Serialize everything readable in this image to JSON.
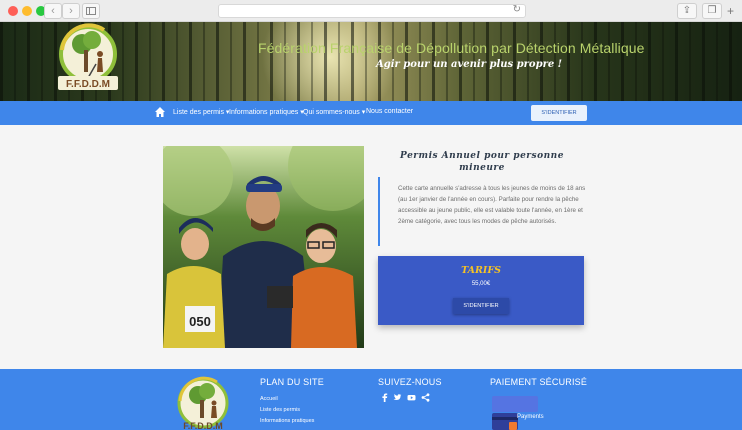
{
  "browser": {
    "reload_icon": "reload-icon"
  },
  "header": {
    "logo_text": "F.F.D.D.M",
    "title": "Fédération Française de Dépollution par Détection Métallique",
    "tagline": "Agir pour un avenir plus propre !"
  },
  "nav": {
    "items": [
      {
        "label": "Liste des permis"
      },
      {
        "label": "Informations pratiques"
      },
      {
        "label": "Qui sommes-nous"
      },
      {
        "label": "Nous contacter"
      }
    ],
    "login": "S'IDENTIFIER"
  },
  "product": {
    "title_line1": "Permis Annuel pour personne",
    "title_line2": "mineure",
    "description": "Cette carte annuelle s'adresse à tous les jeunes de moins de 18 ans (au 1er janvier de l'année en cours). Parfaite pour rendre la pêche accessible au jeune public, elle est valable toute l'année, en 1ère et 2ème catégorie, avec tous les modes de pêche autorisés.",
    "photo_bib": "050"
  },
  "tarifs": {
    "title": "TARIFS",
    "price": "55,00€",
    "button": "S'IDENTIFIER"
  },
  "footer": {
    "logo_text": "F.F.D.D.M",
    "plan_title": "PLAN DU SITE",
    "plan_links": [
      "Accueil",
      "Liste des permis",
      "Informations pratiques"
    ],
    "social_title": "SUIVEZ-NOUS",
    "payment_title": "PAIEMENT SÉCURISÉ",
    "payment_label": "Payments"
  },
  "colors": {
    "nav_blue": "#3f86ea",
    "tarif_blue": "#3a5ac6",
    "tarif_gold": "#f6c324",
    "title_green": "#b9d36c"
  }
}
